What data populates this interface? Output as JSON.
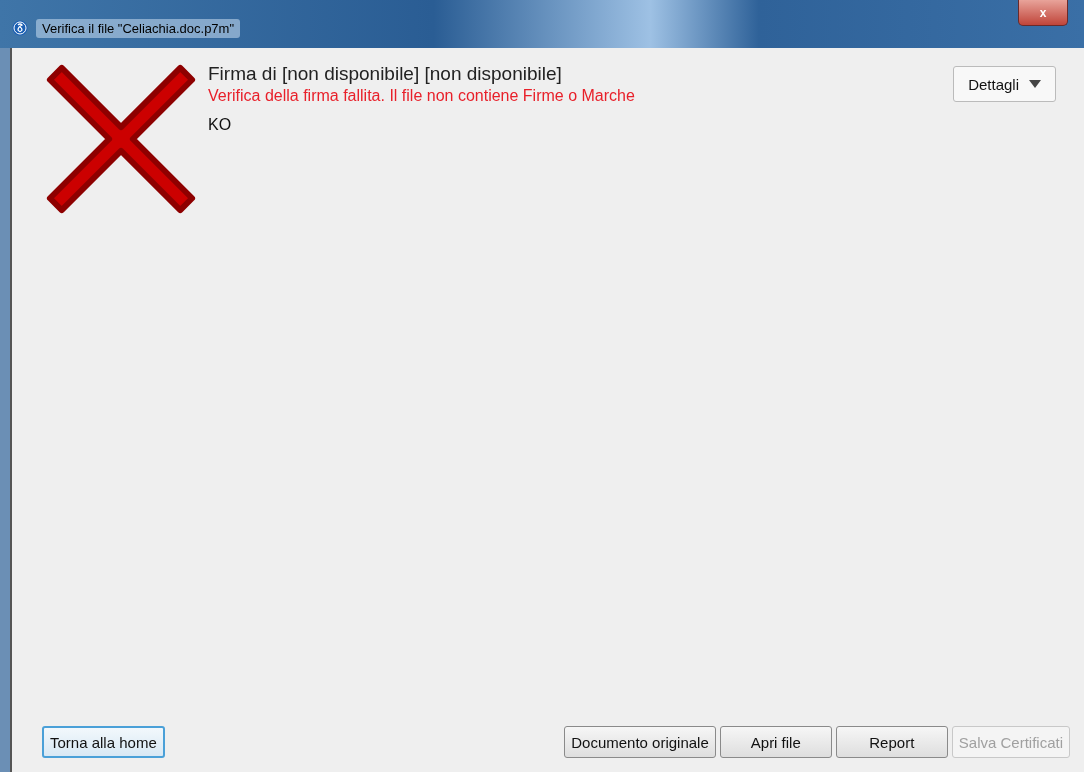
{
  "window": {
    "title": "Verifica il file \"Celiachia.doc.p7m\"",
    "close_label": "x"
  },
  "result": {
    "verified": false,
    "heading": "Firma di [non disponibile] [non disponibile]",
    "message": "Verifica della firma fallita. Il file non contiene Firme o Marche",
    "code": "KO"
  },
  "details_button": {
    "label": "Dettagli",
    "expanded": false
  },
  "buttons_left": [
    {
      "label": "Torna alla home",
      "focused": true,
      "disabled": false
    }
  ],
  "buttons_right": [
    {
      "label": "Documento originale",
      "focused": false,
      "disabled": false
    },
    {
      "label": "Apri file",
      "focused": false,
      "disabled": false
    },
    {
      "label": "Report",
      "focused": false,
      "disabled": false
    },
    {
      "label": "Salva Certificati",
      "focused": false,
      "disabled": true
    }
  ]
}
